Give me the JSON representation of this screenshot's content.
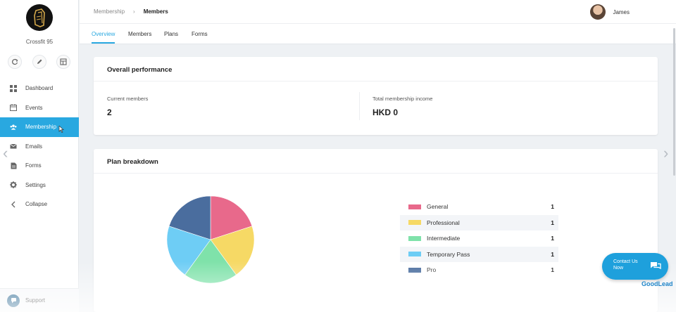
{
  "sidebar": {
    "brand": "Crossfit 95",
    "quick_actions": [
      "refresh-icon",
      "edit-icon",
      "layout-icon"
    ],
    "items": [
      {
        "label": "Dashboard",
        "icon": "dashboard-icon"
      },
      {
        "label": "Events",
        "icon": "calendar-icon"
      },
      {
        "label": "Membership",
        "icon": "users-icon",
        "active": true
      },
      {
        "label": "Emails",
        "icon": "mail-icon"
      },
      {
        "label": "Forms",
        "icon": "form-icon"
      },
      {
        "label": "Settings",
        "icon": "gear-icon"
      },
      {
        "label": "Collapse",
        "icon": "chevron-left-icon"
      }
    ],
    "support": "Support"
  },
  "topbar": {
    "breadcrumb": [
      "Membership",
      "Members"
    ],
    "user_name": "James"
  },
  "tabs": [
    "Overview",
    "Members",
    "Plans",
    "Forms"
  ],
  "active_tab": "Overview",
  "overall": {
    "title": "Overall performance",
    "current_members_label": "Current members",
    "current_members_value": "2",
    "income_label": "Total membership income",
    "income_value": "HKD 0"
  },
  "breakdown": {
    "title": "Plan breakdown",
    "plans": [
      {
        "name": "General",
        "count": "1",
        "color": "#e8698b"
      },
      {
        "name": "Professional",
        "count": "1",
        "color": "#f6d965"
      },
      {
        "name": "Intermediate",
        "count": "1",
        "color": "#7fe2aa"
      },
      {
        "name": "Temporary Pass",
        "count": "1",
        "color": "#6ecdf5"
      },
      {
        "name": "Pro",
        "count": "1",
        "color": "#4a6d9e"
      }
    ]
  },
  "chart_data": {
    "type": "pie",
    "categories": [
      "General",
      "Professional",
      "Intermediate",
      "Temporary Pass",
      "Pro"
    ],
    "values": [
      1,
      1,
      1,
      1,
      1
    ],
    "colors": [
      "#e8698b",
      "#f6d965",
      "#7fe2aa",
      "#6ecdf5",
      "#4a6d9e"
    ],
    "title": "Plan breakdown",
    "legend": "right"
  },
  "contact": {
    "line1": "Contact Us",
    "line2": "Now"
  },
  "widget_brand": "GoodLead"
}
